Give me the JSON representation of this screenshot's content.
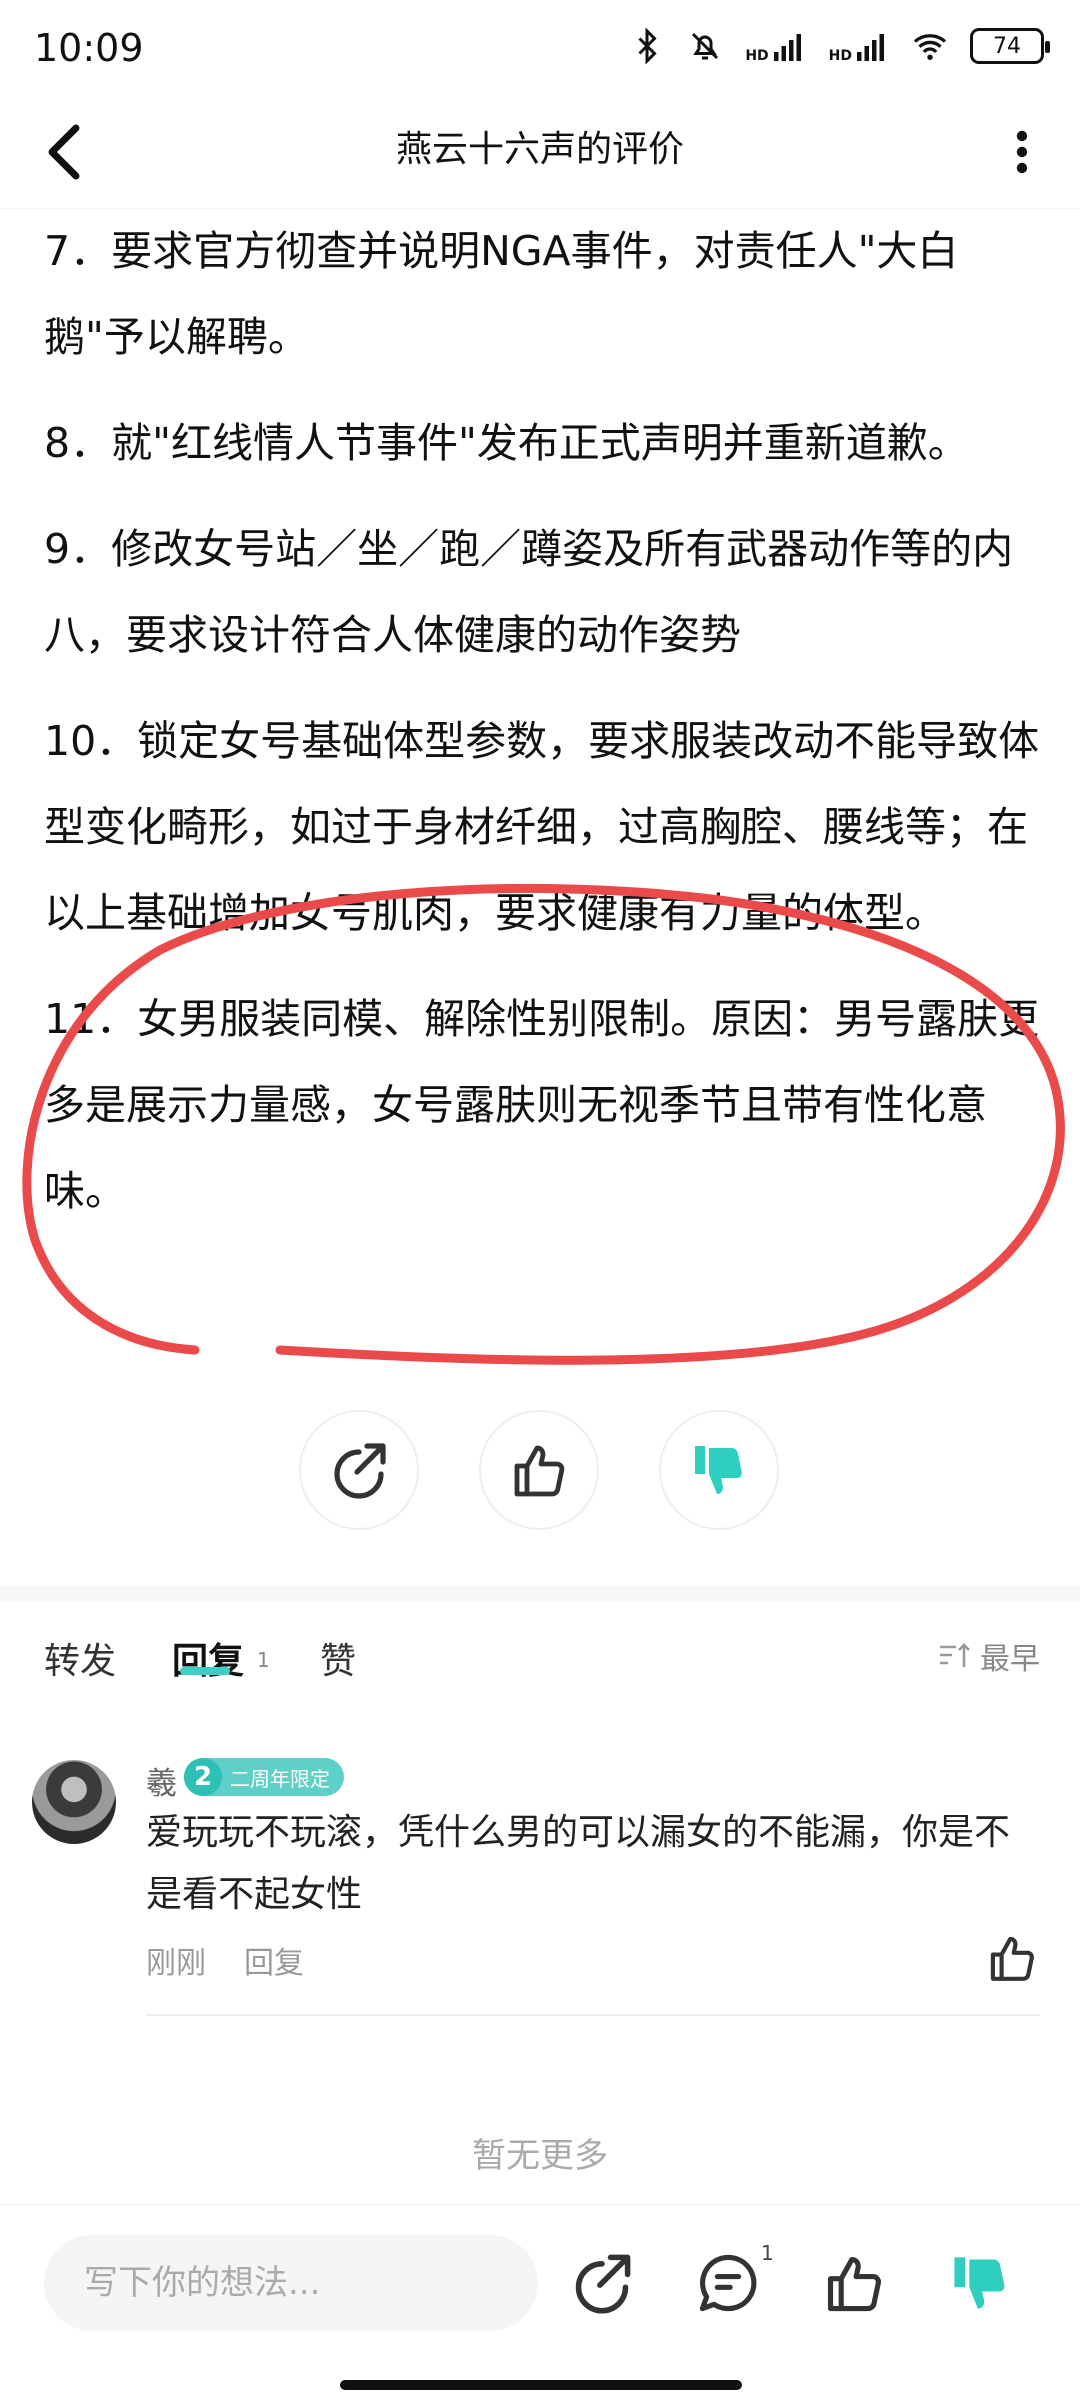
{
  "status_bar": {
    "time": "10:09",
    "battery": "74",
    "hd1": "HD",
    "hd2": "HD"
  },
  "header": {
    "title": "燕云十六声的评价"
  },
  "content": {
    "paragraphs": [
      "7．要求官方彻查并说明NGA事件，对责任人\"大白鹅\"予以解聘。",
      "8．就\"红线情人节事件\"发布正式声明并重新道歉。",
      "9．修改女号站／坐／跑／蹲姿及所有武器动作等的内八，要求设计符合人体健康的动作姿势",
      "10．锁定女号基础体型参数，要求服装改动不能导致体型变化畸形，如过于身材纤细，过高胸腔、腰线等；在以上基础增加女号肌肉，要求健康有力量的体型。",
      "11．女男服装同模、解除性别限制。原因：男号露肤更多是展示力量感，女号露肤则无视季节且带有性化意味。"
    ]
  },
  "tabs": {
    "forward": "转发",
    "reply": "回复",
    "reply_count": "1",
    "like": "赞",
    "sort": "最早"
  },
  "comment": {
    "username": "羲",
    "badge_number": "2",
    "badge_text": "二周年限定",
    "text": "爱玩玩不玩滚，凭什么男的可以漏女的不能漏，你是不是看不起女性",
    "time": "刚刚",
    "reply_label": "回复"
  },
  "no_more": "暂无更多",
  "bottom_bar": {
    "input_placeholder": "写下你的想法...",
    "comment_count": "1"
  },
  "colors": {
    "accent": "#38d1c4",
    "annotation": "#ea4a4a"
  }
}
